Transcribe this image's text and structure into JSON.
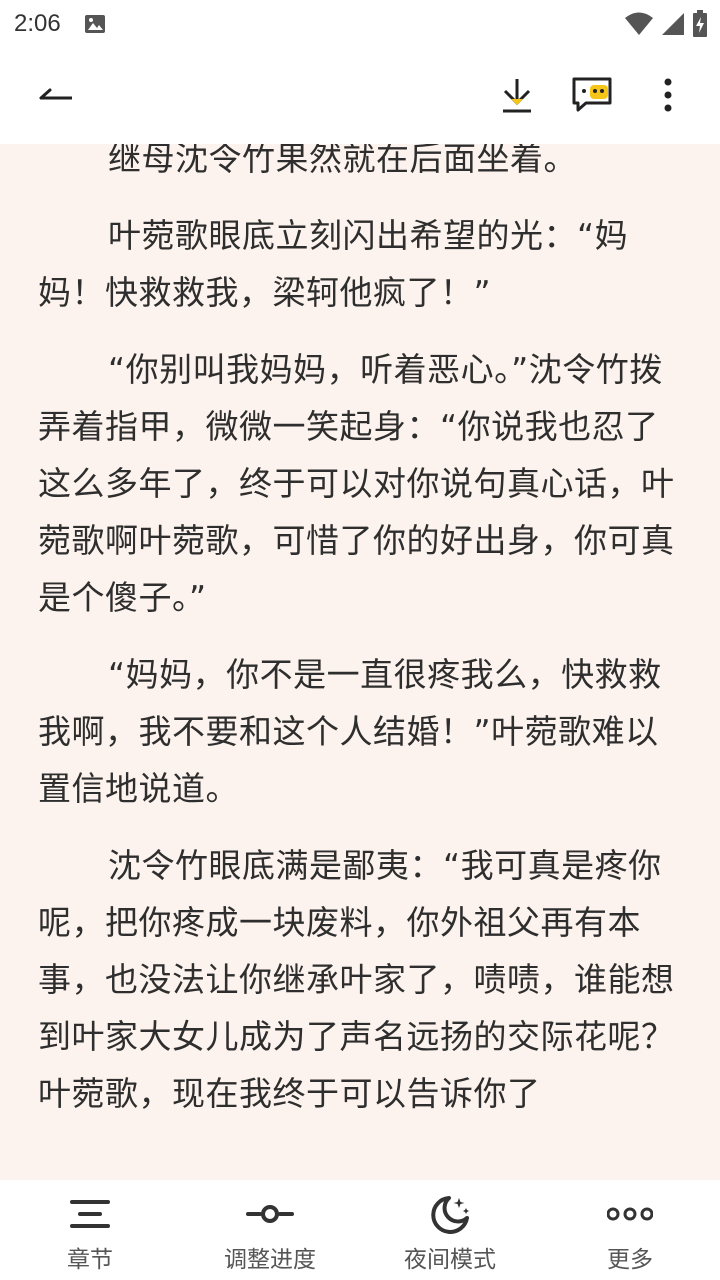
{
  "status_bar": {
    "time": "2:06"
  },
  "top_bar": {
    "icons": [
      "back-arrow-icon",
      "download-icon",
      "comment-icon",
      "more-vertical-icon"
    ],
    "accent_color": "#f5c518"
  },
  "content": {
    "paragraphs": [
      "继母沈令竹果然就在后面坐着。",
      "叶菀歌眼底立刻闪出希望的光：“妈妈！快救救我，梁轲他疯了！”",
      "“你别叫我妈妈，听着恶心。”沈令竹拨弄着指甲，微微一笑起身：“你说我也忍了这么多年了，终于可以对你说句真心话，叶菀歌啊叶菀歌，可惜了你的好出身，你可真是个傻子。”",
      "“妈妈，你不是一直很疼我么，快救救我啊，我不要和这个人结婚！”叶菀歌难以置信地说道。",
      "沈令竹眼底满是鄙夷：“我可真是疼你呢，把你疼成一块废料，你外祖父再有本事，也没法让你继承叶家了，啧啧，谁能想到叶家大女儿成为了声名远扬的交际花呢？叶菀歌，现在我终于可以告诉你了"
    ],
    "background_color": "#fdf3ee"
  },
  "bottom_nav": {
    "items": [
      {
        "label": "章节",
        "icon": "menu-list-icon"
      },
      {
        "label": "调整进度",
        "icon": "progress-slider-icon"
      },
      {
        "label": "夜间模式",
        "icon": "night-moon-icon"
      },
      {
        "label": "更多",
        "icon": "more-horizontal-icon"
      }
    ]
  }
}
